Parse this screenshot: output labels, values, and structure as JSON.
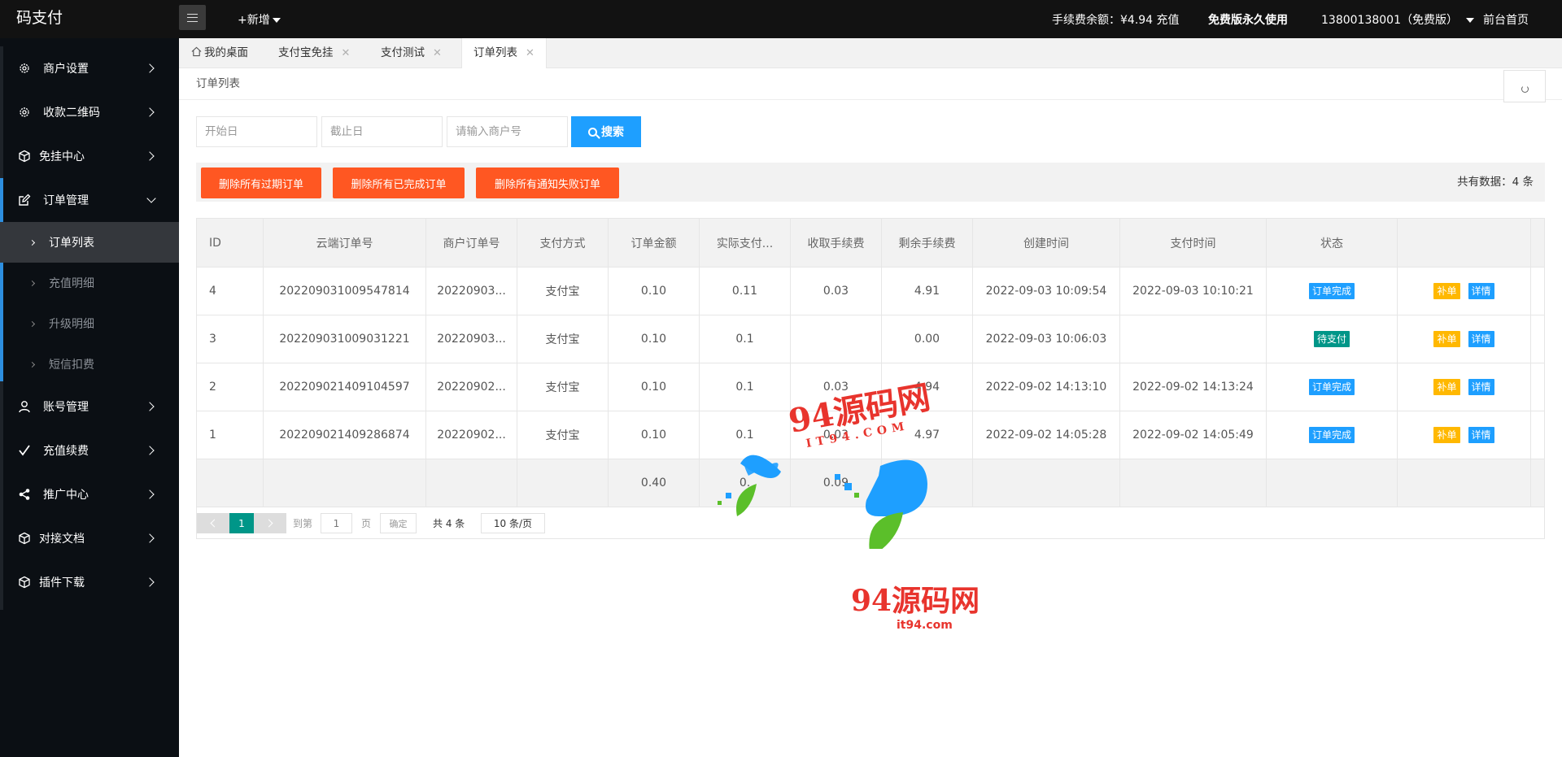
{
  "header": {
    "logo": "码支付",
    "add_new": "+新增",
    "balance": "手续费余额：¥4.94 充值",
    "free_text": "免费版永久使用",
    "user": "13800138001（免费版）",
    "home": "前台首页"
  },
  "sidebar": {
    "items": [
      {
        "label": "商户设置",
        "icon": "gear-icon"
      },
      {
        "label": "收款二维码",
        "icon": "gear-icon"
      },
      {
        "label": "免挂中心",
        "icon": "cube-icon"
      },
      {
        "label": "订单管理",
        "icon": "edit-icon",
        "expanded": true
      },
      {
        "label": "账号管理",
        "icon": "user-icon"
      },
      {
        "label": "充值续费",
        "icon": "check-icon"
      },
      {
        "label": "推广中心",
        "icon": "share-icon"
      },
      {
        "label": "对接文档",
        "icon": "cube-icon"
      },
      {
        "label": "插件下载",
        "icon": "cube-icon"
      }
    ],
    "sub_items": [
      {
        "label": "订单列表",
        "active": true
      },
      {
        "label": "充值明细"
      },
      {
        "label": "升级明细"
      },
      {
        "label": "短信扣费"
      }
    ]
  },
  "tabs": [
    {
      "label": "我的桌面",
      "icon": "home-icon"
    },
    {
      "label": "支付宝免挂"
    },
    {
      "label": "支付测试"
    },
    {
      "label": "订单列表",
      "active": true
    }
  ],
  "breadcrumb": "订单列表",
  "filters": {
    "start_placeholder": "开始日",
    "end_placeholder": "截止日",
    "merchant_placeholder": "请输入商户号",
    "search_label": "搜索"
  },
  "toolbar": {
    "delete_expired": "删除所有过期订单",
    "delete_completed": "删除所有已完成订单",
    "delete_failed": "删除所有通知失败订单",
    "total": "共有数据：4 条"
  },
  "table": {
    "headers": [
      "ID",
      "云端订单号",
      "商户订单号",
      "支付方式",
      "订单金额",
      "实际支付...",
      "收取手续费",
      "剩余手续费",
      "创建时间",
      "支付时间",
      "状态",
      ""
    ],
    "rows": [
      {
        "id": "4",
        "cloud_no": "202209031009547814",
        "merchant_no": "20220903...",
        "method": "支付宝",
        "amount": "0.10",
        "actual": "0.11",
        "fee": "0.03",
        "remain": "4.91",
        "created": "2022-09-03 10:09:54",
        "paid": "2022-09-03 10:10:21",
        "status": "订单完成",
        "status_type": "done"
      },
      {
        "id": "3",
        "cloud_no": "202209031009031221",
        "merchant_no": "20220903...",
        "method": "支付宝",
        "amount": "0.10",
        "actual": "0.1",
        "fee": "",
        "remain": "0.00",
        "created": "2022-09-03 10:06:03",
        "paid": "",
        "status": "待支付",
        "status_type": "wait"
      },
      {
        "id": "2",
        "cloud_no": "202209021409104597",
        "merchant_no": "20220902...",
        "method": "支付宝",
        "amount": "0.10",
        "actual": "0.1",
        "fee": "0.03",
        "remain": "4.94",
        "created": "2022-09-02 14:13:10",
        "paid": "2022-09-02 14:13:24",
        "status": "订单完成",
        "status_type": "done"
      },
      {
        "id": "1",
        "cloud_no": "202209021409286874",
        "merchant_no": "20220902...",
        "method": "支付宝",
        "amount": "0.10",
        "actual": "0.1",
        "fee": "0.03",
        "remain": "4.97",
        "created": "2022-09-02 14:05:28",
        "paid": "2022-09-02 14:05:49",
        "status": "订单完成",
        "status_type": "done"
      }
    ],
    "summary": {
      "amount": "0.40",
      "actual": "0.",
      "fee": "0.09"
    },
    "action_bd": "补单",
    "action_xq": "详情"
  },
  "pagination": {
    "current": "1",
    "goto_label": "到第",
    "page_input": "1",
    "page_unit": "页",
    "confirm": "确定",
    "total": "共 4 条",
    "page_size": "10 条/页"
  },
  "watermark": {
    "title": "94源码网",
    "sub": "IT94.COM",
    "url": "it94.com"
  },
  "colors": {
    "header_bg": "#121212",
    "sidebar_bg": "#0b0f14",
    "accent_blue": "#1e9fff",
    "danger": "#ff5722",
    "teal": "#009688",
    "warn": "#ffb800"
  }
}
